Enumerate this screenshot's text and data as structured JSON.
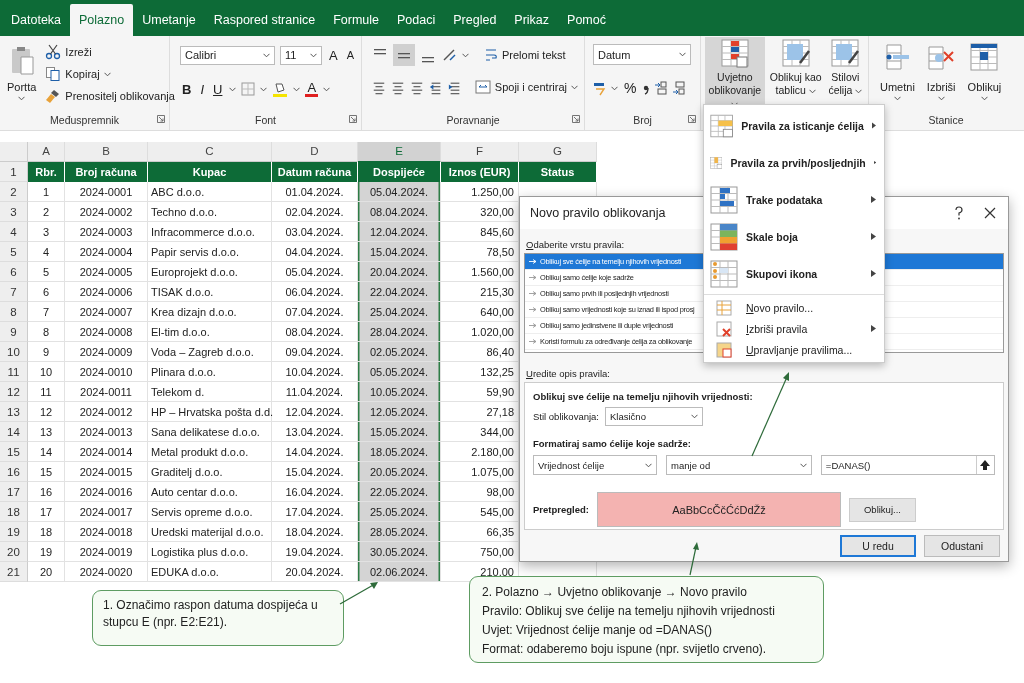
{
  "tabs": [
    {
      "label": "Datoteka",
      "selected": false
    },
    {
      "label": "Polazno",
      "selected": true
    },
    {
      "label": "Umetanje",
      "selected": false
    },
    {
      "label": "Raspored stranice",
      "selected": false
    },
    {
      "label": "Formule",
      "selected": false
    },
    {
      "label": "Podaci",
      "selected": false
    },
    {
      "label": "Pregled",
      "selected": false
    },
    {
      "label": "Prikaz",
      "selected": false
    },
    {
      "label": "Pomoć",
      "selected": false
    }
  ],
  "ribbon": {
    "clipboard": {
      "title": "Međuspremnik",
      "paste": "Portta",
      "cut": "Izreži",
      "copy": "Kopiraj",
      "format_painter": "Prenositelj oblikovanja"
    },
    "font": {
      "title": "Font",
      "font_name": "Calibri",
      "font_size": "11",
      "grow": "A",
      "shrink": "A",
      "bold": "B",
      "italic": "I",
      "underline": "U",
      "font_color": "A"
    },
    "alignment": {
      "title": "Poravnanje",
      "wrap_text": "Prelomi tekst",
      "merge": "Spoji i centriraj"
    },
    "number": {
      "title": "Broj",
      "format": "Datum",
      "percent": "%"
    },
    "styles": [
      {
        "label": "Uvjetno oblikovanje",
        "selected": true
      },
      {
        "label": "Oblikuj kao tablicu",
        "selected": false
      },
      {
        "label": "Stilovi ćelija",
        "selected": false
      }
    ],
    "cells": {
      "title": "Stanice",
      "buttons": [
        "Umetni",
        "Izbriši",
        "Oblikuj"
      ]
    }
  },
  "sheet": {
    "columns": [
      {
        "letter": "A",
        "selected": false
      },
      {
        "letter": "B",
        "selected": false
      },
      {
        "letter": "C",
        "selected": false
      },
      {
        "letter": "D",
        "selected": false
      },
      {
        "letter": "E",
        "selected": true
      },
      {
        "letter": "F",
        "selected": false
      },
      {
        "letter": "G",
        "selected": false
      }
    ],
    "header_row": "1",
    "headers": [
      "Rbr.",
      "Broj računa",
      "Kupac",
      "Datum računa",
      "Dospijeće",
      "Iznos (EUR)",
      "Status"
    ],
    "rows": [
      {
        "row": "2",
        "cells": [
          "1",
          "2024-0001",
          "ABC d.o.o.",
          "01.04.2024.",
          "05.04.2024.",
          "1.250,00"
        ]
      },
      {
        "row": "3",
        "cells": [
          "2",
          "2024-0002",
          "Techno d.o.o.",
          "02.04.2024.",
          "08.04.2024.",
          "320,00"
        ]
      },
      {
        "row": "4",
        "cells": [
          "3",
          "2024-0003",
          "Infracommerce d.o.o.",
          "03.04.2024.",
          "12.04.2024.",
          "845,60"
        ]
      },
      {
        "row": "5",
        "cells": [
          "4",
          "2024-0004",
          "Papir servis d.o.o.",
          "04.04.2024.",
          "15.04.2024.",
          "78,50"
        ]
      },
      {
        "row": "6",
        "cells": [
          "5",
          "2024-0005",
          "Europrojekt d.o.o.",
          "05.04.2024.",
          "20.04.2024.",
          "1.560,00"
        ]
      },
      {
        "row": "7",
        "cells": [
          "6",
          "2024-0006",
          "TISAK d.o.o.",
          "06.04.2024.",
          "22.04.2024.",
          "215,30"
        ]
      },
      {
        "row": "8",
        "cells": [
          "7",
          "2024-0007",
          "Krea dizajn d.o.o.",
          "07.04.2024.",
          "25.04.2024.",
          "640,00"
        ]
      },
      {
        "row": "9",
        "cells": [
          "8",
          "2024-0008",
          "El-tim d.o.o.",
          "08.04.2024.",
          "28.04.2024.",
          "1.020,00"
        ]
      },
      {
        "row": "10",
        "cells": [
          "9",
          "2024-0009",
          "Voda – Zagreb d.o.o.",
          "09.04.2024.",
          "02.05.2024.",
          "86,40"
        ]
      },
      {
        "row": "11",
        "cells": [
          "10",
          "2024-0010",
          "Plinara d.o.o.",
          "10.04.2024.",
          "05.05.2024.",
          "132,25"
        ]
      },
      {
        "row": "12",
        "cells": [
          "11",
          "2024-0011",
          "Telekom d.",
          "11.04.2024.",
          "10.05.2024.",
          "59,90"
        ]
      },
      {
        "row": "13",
        "cells": [
          "12",
          "2024-0012",
          "HP – Hrvatska pošta d.d.",
          "12.04.2024.",
          "12.05.2024.",
          "27,18"
        ]
      },
      {
        "row": "14",
        "cells": [
          "13",
          "2024-0013",
          "Sana delikatese d.o.o.",
          "13.04.2024.",
          "15.05.2024.",
          "344,00"
        ]
      },
      {
        "row": "15",
        "cells": [
          "14",
          "2024-0014",
          "Metal produkt d.o.o.",
          "14.04.2024.",
          "18.05.2024.",
          "2.180,00"
        ]
      },
      {
        "row": "16",
        "cells": [
          "15",
          "2024-0015",
          "Graditelj d.o.o.",
          "15.04.2024.",
          "20.05.2024.",
          "1.075,00"
        ]
      },
      {
        "row": "17",
        "cells": [
          "16",
          "2024-0016",
          "Auto centar d.o.o.",
          "16.04.2024.",
          "22.05.2024.",
          "98,00"
        ]
      },
      {
        "row": "18",
        "cells": [
          "17",
          "2024-0017",
          "Servis opreme d.o.o.",
          "17.04.2024.",
          "25.05.2024.",
          "545,00"
        ]
      },
      {
        "row": "19",
        "cells": [
          "18",
          "2024-0018",
          "Uredski materijal d.o.o.",
          "18.04.2024.",
          "28.05.2024.",
          "66,35"
        ]
      },
      {
        "row": "20",
        "cells": [
          "19",
          "2024-0019",
          "Logistika plus d.o.o.",
          "19.04.2024.",
          "30.05.2024.",
          "750,00"
        ]
      },
      {
        "row": "21",
        "cells": [
          "20",
          "2024-0020",
          "EDUKA d.o.o.",
          "20.04.2024.",
          "02.06.2024.",
          "210,00"
        ]
      }
    ]
  },
  "menu": {
    "items": [
      {
        "kind": "large",
        "label": "Pravila za isticanje ćelija",
        "submenu": true
      },
      {
        "kind": "large",
        "label": "Pravila za prvih/posljednjih",
        "submenu": true
      },
      {
        "kind": "large",
        "label": "Trake podataka",
        "submenu": true
      },
      {
        "kind": "large",
        "label": "Skale boja",
        "submenu": true
      },
      {
        "kind": "large",
        "label": "Skupovi ikona",
        "submenu": true
      },
      {
        "kind": "small",
        "label": "Novo pravilo...",
        "submenu": false
      },
      {
        "kind": "small",
        "label": "Izbriši pravila",
        "submenu": true
      },
      {
        "kind": "small",
        "label": "Upravljanje pravilima...",
        "submenu": false
      }
    ]
  },
  "dialog": {
    "title": "Novo pravilo oblikovanja",
    "rule_type_label": "Odaberite vrstu pravila:",
    "rule_types": [
      {
        "label": "Oblikuj sve ćelije na temelju njihovih vrijednosti",
        "selected": true
      },
      {
        "label": "Oblikuj samo ćelije koje sadrže",
        "selected": false
      },
      {
        "label": "Oblikuj samo prvih ili posljednjih vrijednosti",
        "selected": false
      },
      {
        "label": "Oblikuj samo vrijednosti koje su iznad ili ispod prosj",
        "selected": false
      },
      {
        "label": "Oblikuj samo jedinstvene ili duple vrijednosti",
        "selected": false
      },
      {
        "label": "Koristi formulu za određivanje ćelija za oblikovanje",
        "selected": false
      }
    ],
    "edit_label": "Uredite opis pravila:",
    "description_heading": "Oblikuj sve ćelije na temelju njihovih vrijednosti:",
    "style_label": "Stil oblikovanja:",
    "style_value": "Klasično",
    "condition_heading": "Formatiraj samo ćelije koje sadrže:",
    "condition_subject": "Vrijednost ćelije",
    "condition_operator": "manje od",
    "condition_value": "=DANAS()",
    "preview_label": "Pretpregled:",
    "preview_text": "AaBbCcČčĆćDdŽž",
    "format_button": "Oblikuj...",
    "ok_button": "U redu",
    "cancel_button": "Odustani"
  },
  "callouts": [
    {
      "text": "1. Označimo raspon datuma dospijeća u stupcu E (npr. E2:E21)."
    },
    {
      "lines": [
        "2. Polazno → Uvjetno oblikovanje → Novo pravilo",
        "Pravilo: Oblikuj sve ćelije na temelju njihovih vrijednosti",
        "Uvjet: Vrijednost ćelije manje od =DANAS()",
        "Format: odaberemo boju ispune (npr. svijetlo crveno)."
      ]
    }
  ]
}
